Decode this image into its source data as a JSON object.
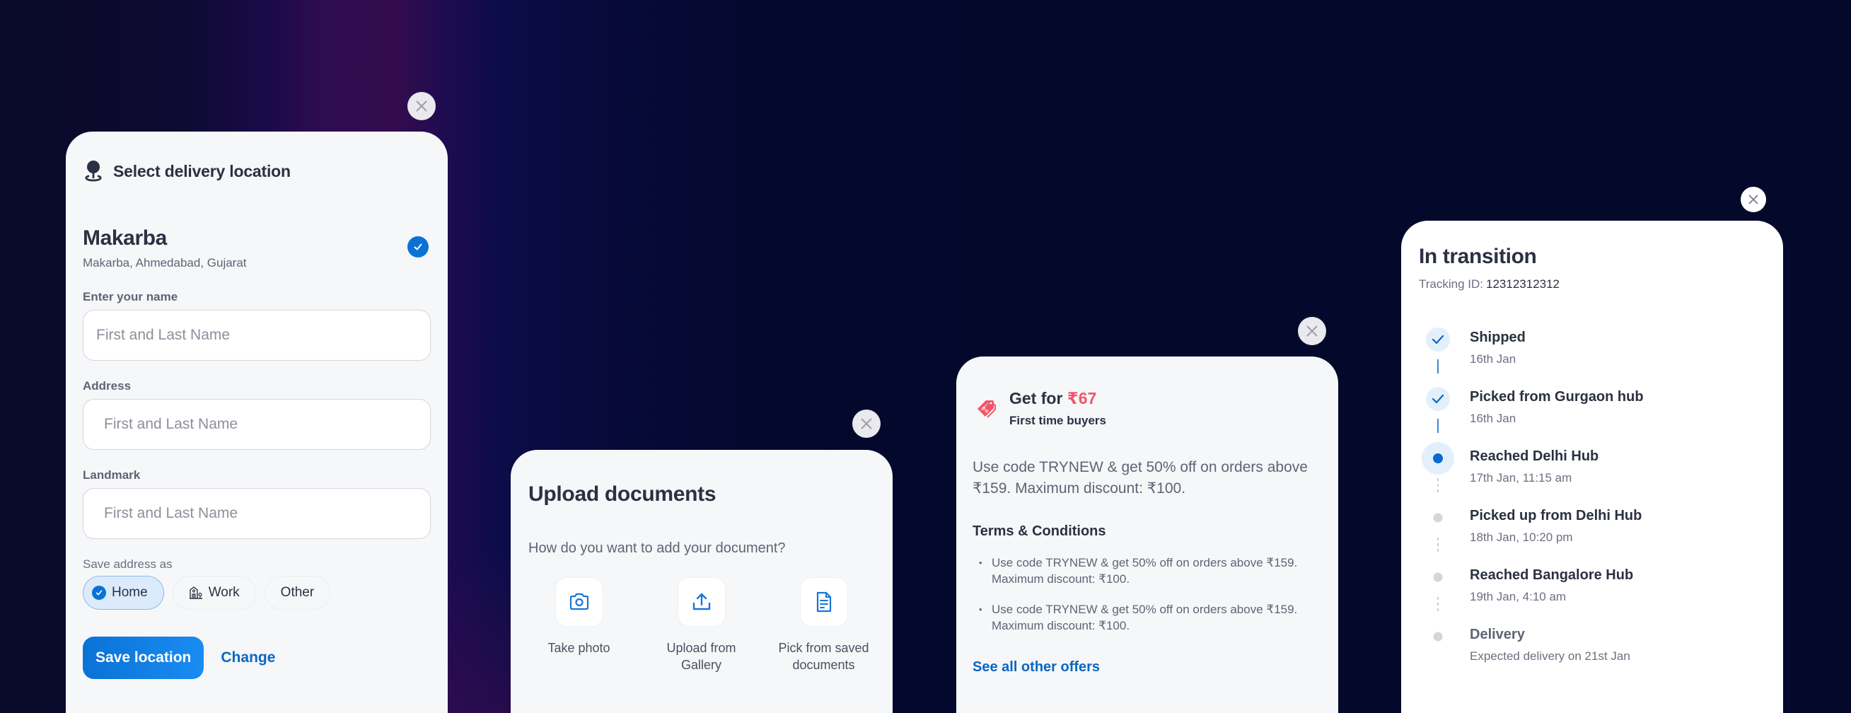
{
  "location_modal": {
    "title": "Select delivery location",
    "place_name": "Makarba",
    "place_address": "Makarba, Ahmedabad, Gujarat",
    "place_selected": true,
    "fields": [
      {
        "label": "Enter your name",
        "placeholder": "First and Last Name",
        "value": ""
      },
      {
        "label": "Address",
        "placeholder": "First and Last Name",
        "value": ""
      },
      {
        "label": "Landmark",
        "placeholder": "First and Last Name",
        "value": ""
      }
    ],
    "save_as_label": "Save address as",
    "save_as_options": [
      {
        "label": "Home",
        "icon": "check-circle-icon",
        "selected": true
      },
      {
        "label": "Work",
        "icon": "office-building-icon",
        "selected": false
      },
      {
        "label": "Other",
        "icon": "",
        "selected": false
      }
    ],
    "primary_button": "Save location",
    "secondary_link": "Change"
  },
  "upload_modal": {
    "title": "Upload documents",
    "question": "How do you want to add your document?",
    "options": [
      {
        "label": "Take photo",
        "icon": "camera-icon"
      },
      {
        "label": "Upload from\nGallery",
        "icon": "upload-icon"
      },
      {
        "label": "Pick from saved\ndocuments",
        "icon": "document-icon"
      }
    ]
  },
  "offer_modal": {
    "title_prefix": "Get for ",
    "price": "₹67",
    "subtitle": "First time buyers",
    "description": "Use code TRYNEW & get 50% off on orders above ₹159. Maximum discount: ₹100.",
    "terms_title": "Terms & Conditions",
    "terms": [
      "Use code TRYNEW & get 50% off on orders above ₹159. Maximum discount: ₹100.",
      "Use code TRYNEW & get 50% off on orders above ₹159. Maximum discount: ₹100."
    ],
    "see_all_link": "See all other offers",
    "accent_color": "#f0566b"
  },
  "tracking_modal": {
    "title": "In transition",
    "tracking_label": "Tracking ID:",
    "tracking_id": "12312312312",
    "steps": [
      {
        "title": "Shipped",
        "subtitle": "16th Jan",
        "status": "done"
      },
      {
        "title": "Picked from Gurgaon hub",
        "subtitle": "16th Jan",
        "status": "done"
      },
      {
        "title": "Reached Delhi Hub",
        "subtitle": "17th Jan, 11:15 am",
        "status": "current"
      },
      {
        "title": "Picked up from Delhi Hub",
        "subtitle": "18th Jan, 10:20 pm",
        "status": "pending"
      },
      {
        "title": "Reached Bangalore Hub",
        "subtitle": "19th Jan, 4:10 am",
        "status": "pending"
      },
      {
        "title": "Delivery",
        "subtitle": "Expected delivery on 21st Jan",
        "status": "pending"
      }
    ]
  },
  "colors": {
    "primary": "#0a72d6",
    "link": "#0a66c2",
    "text": "#2b3142",
    "muted": "#5e6474"
  }
}
